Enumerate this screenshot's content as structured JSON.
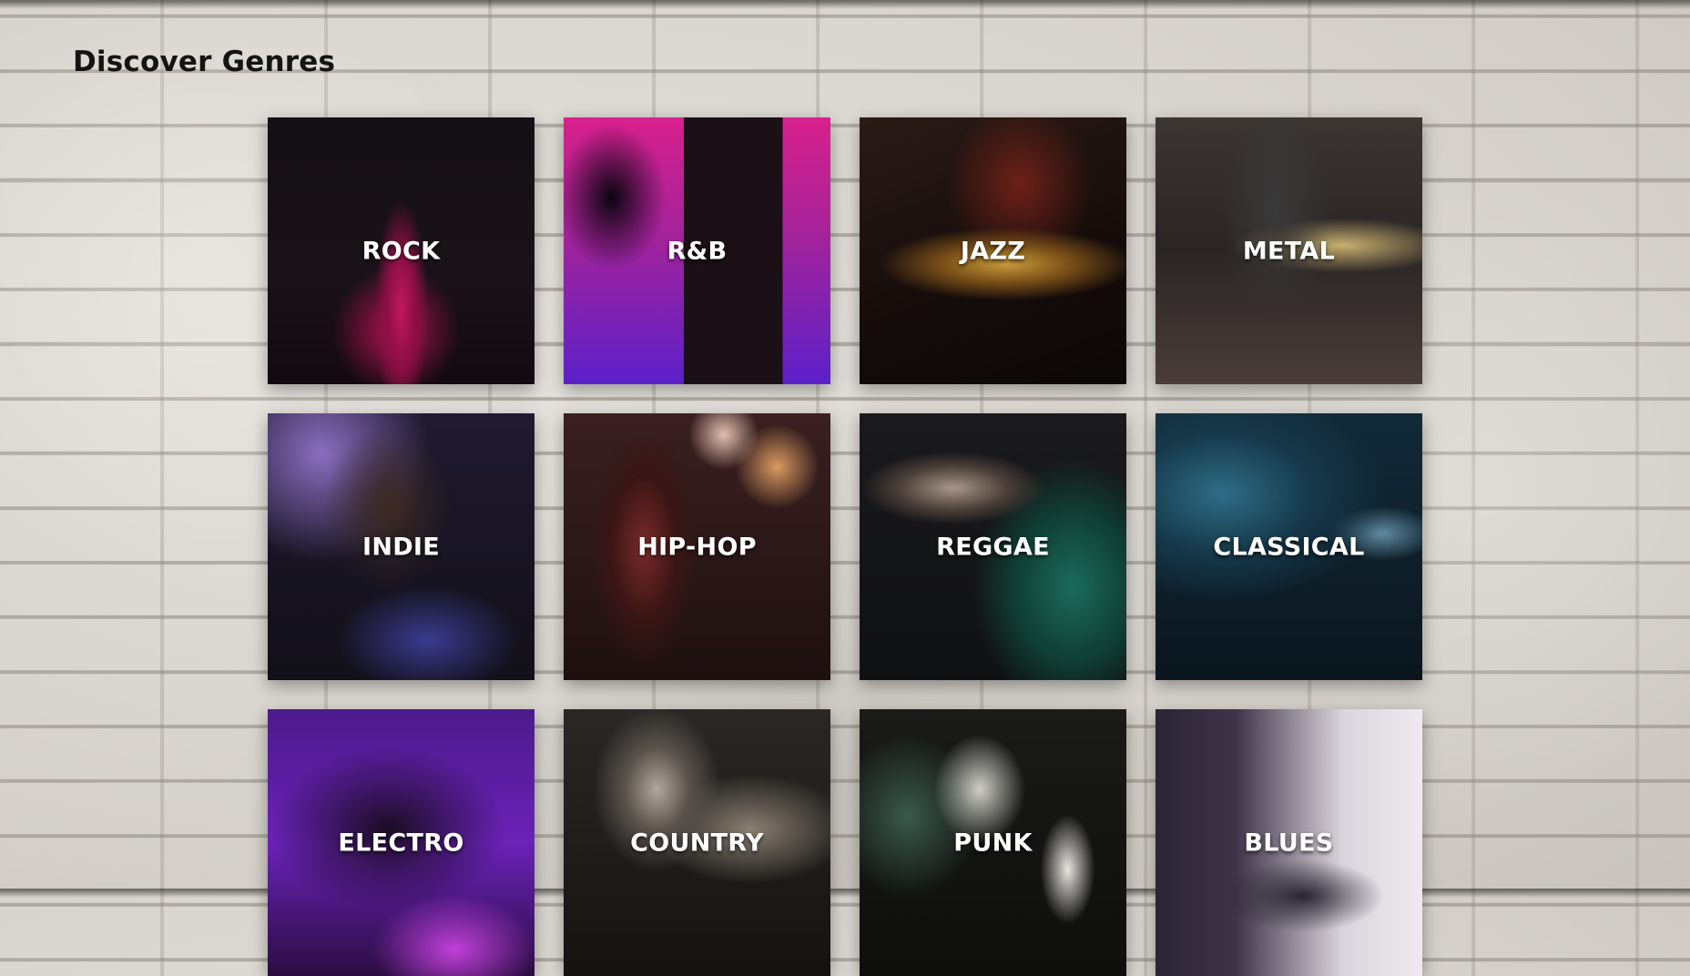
{
  "page": {
    "title": "Discover Genres"
  },
  "genres": [
    {
      "label": "ROCK",
      "icon": "electric-guitar-photo"
    },
    {
      "label": "R&B",
      "icon": "singer-silhouette-photo"
    },
    {
      "label": "JAZZ",
      "icon": "trumpet-photo"
    },
    {
      "label": "METAL",
      "icon": "guitarist-photo"
    },
    {
      "label": "INDIE",
      "icon": "long-haired-guitarist-photo"
    },
    {
      "label": "HIP-HOP",
      "icon": "vintage-microphone-photo"
    },
    {
      "label": "REGGAE",
      "icon": "drummer-cymbal-photo"
    },
    {
      "label": "CLASSICAL",
      "icon": "music-stand-stage-photo"
    },
    {
      "label": "ELECTRO",
      "icon": "dj-turntable-photo"
    },
    {
      "label": "COUNTRY",
      "icon": "acoustic-guitar-photo"
    },
    {
      "label": "PUNK",
      "icon": "punk-band-live-photo"
    },
    {
      "label": "BLUES",
      "icon": "drum-kit-room-photo"
    }
  ],
  "colors": {
    "background": "#dcd9d3",
    "title": "#141414",
    "label": "#ffffff"
  }
}
